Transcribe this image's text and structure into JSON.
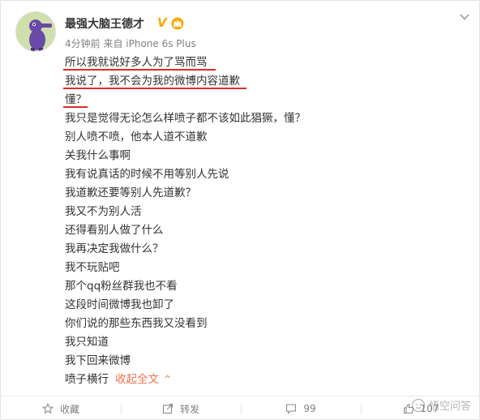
{
  "post": {
    "username": "最强大脑王德才",
    "verified_badge": "V",
    "meta": "4分钟前 来自 iPhone 6s Plus",
    "lines": [
      {
        "text": "所以我就说好多人为了骂而骂",
        "underlined": true
      },
      {
        "text": "我说了，我不会为我的微博内容道歉",
        "underlined": true
      },
      {
        "text": "懂？",
        "underlined": true
      },
      {
        "text": "我只是觉得无论怎么样喷子都不该如此猖獗，懂？",
        "underlined": false
      },
      {
        "text": "别人喷不喷，他本人道不道歉",
        "underlined": false
      },
      {
        "text": "关我什么事啊",
        "underlined": false
      },
      {
        "text": "我有说真话的时候不用等别人先说",
        "underlined": false
      },
      {
        "text": "我道歉还要等别人先道歉？",
        "underlined": false
      },
      {
        "text": "我又不为别人活",
        "underlined": false
      },
      {
        "text": "还得看别人做了什么",
        "underlined": false
      },
      {
        "text": "我再决定我做什么？",
        "underlined": false
      },
      {
        "text": "我不玩贴吧",
        "underlined": false
      },
      {
        "text": "那个qq粉丝群我也不看",
        "underlined": false
      },
      {
        "text": "这段时间微博我也卸了",
        "underlined": false
      },
      {
        "text": "你们说的那些东西我又没看到",
        "underlined": false
      },
      {
        "text": "我只知道",
        "underlined": false
      },
      {
        "text": "我下回来微博",
        "underlined": false
      }
    ],
    "last_line": "喷子横行",
    "collapse_label": "收起全文",
    "collapse_caret": "^"
  },
  "actions": {
    "favorite_label": "收藏",
    "repost_label": "转发",
    "comment_count": "99",
    "like_count": "107"
  },
  "watermark": {
    "text": "悟空问答"
  },
  "colors": {
    "underline": "#e02b2b",
    "link": "#eb7350",
    "meta": "#808080",
    "verified": "#f6a800"
  },
  "icons": {
    "favorite": "star-outline-icon",
    "repost": "share-arrow-icon",
    "comment": "comment-bubble-icon",
    "like": "thumbs-up-icon",
    "more": "chevron-down-icon"
  }
}
